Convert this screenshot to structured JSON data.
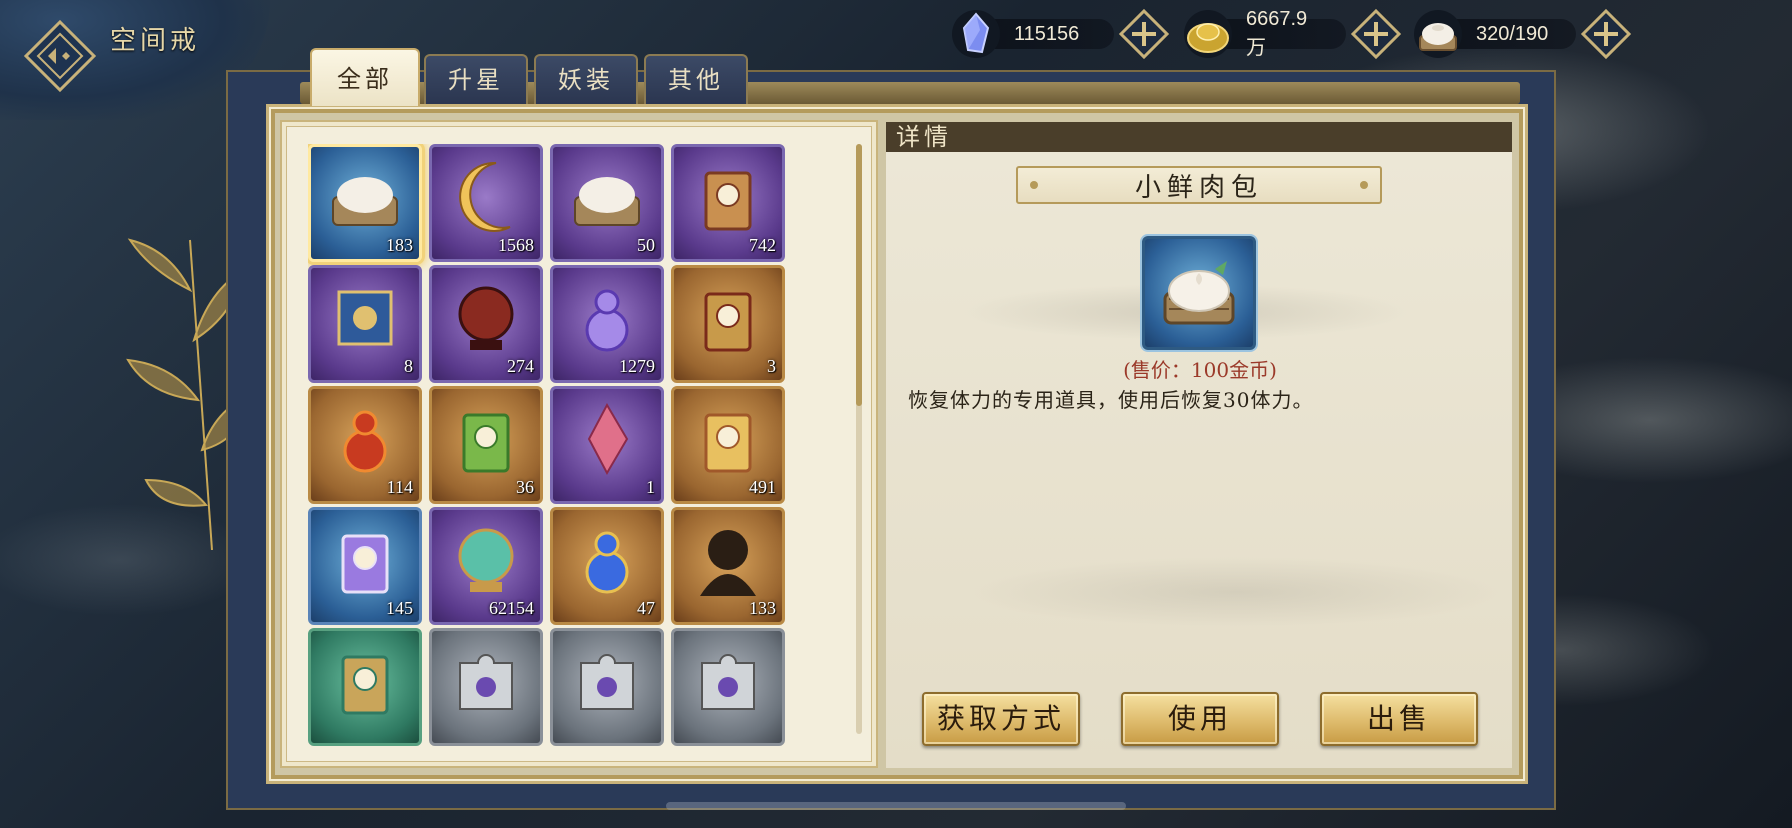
{
  "header": {
    "title": "空间戒",
    "back_icon": "diamond-back-icon"
  },
  "currencies": [
    {
      "name": "crystal",
      "icon": "crystal-icon",
      "value": "115156"
    },
    {
      "name": "gold",
      "icon": "gold-ingot-icon",
      "value": "6667.9万"
    },
    {
      "name": "stamina",
      "icon": "steamed-bun-icon",
      "value": "320/190"
    }
  ],
  "tabs": [
    {
      "label": "全部",
      "active": true
    },
    {
      "label": "升星",
      "active": false
    },
    {
      "label": "妖装",
      "active": false
    },
    {
      "label": "其他",
      "active": false
    }
  ],
  "inventory": {
    "items": [
      {
        "icon": "steamed-bun-icon",
        "count": "183",
        "rarity": "blue",
        "selected": true
      },
      {
        "icon": "crescent-moon-icon",
        "count": "1568",
        "rarity": "purple"
      },
      {
        "icon": "steamed-bun-icon",
        "count": "50",
        "rarity": "purple"
      },
      {
        "icon": "talisman-pouch-icon",
        "count": "742",
        "rarity": "purple"
      },
      {
        "icon": "scroll-icon",
        "count": "8",
        "rarity": "purple"
      },
      {
        "icon": "red-orb-icon",
        "count": "274",
        "rarity": "purple"
      },
      {
        "icon": "purple-gourd-icon",
        "count": "1279",
        "rarity": "purple"
      },
      {
        "icon": "tassel-token-icon",
        "count": "3",
        "rarity": "orange"
      },
      {
        "icon": "red-potion-icon",
        "count": "114",
        "rarity": "orange"
      },
      {
        "icon": "green-talisman-pouch-icon",
        "count": "36",
        "rarity": "orange"
      },
      {
        "icon": "pink-crystal-icon",
        "count": "1",
        "rarity": "purple"
      },
      {
        "icon": "gold-talisman-pouch-icon",
        "count": "491",
        "rarity": "orange"
      },
      {
        "icon": "purple-talisman-pouch-icon",
        "count": "145",
        "rarity": "blue"
      },
      {
        "icon": "jade-orb-icon",
        "count": "62154",
        "rarity": "purple"
      },
      {
        "icon": "blue-gourd-icon",
        "count": "47",
        "rarity": "orange"
      },
      {
        "icon": "silhouette-icon",
        "count": "133",
        "rarity": "orange"
      },
      {
        "icon": "green-item-icon",
        "count": "",
        "rarity": "green"
      },
      {
        "icon": "puzzle-piece-icon",
        "count": "",
        "rarity": "grey"
      },
      {
        "icon": "puzzle-piece-icon",
        "count": "",
        "rarity": "grey"
      },
      {
        "icon": "puzzle-piece-icon",
        "count": "",
        "rarity": "grey"
      }
    ]
  },
  "detail": {
    "header": "详情",
    "item_name": "小鲜肉包",
    "item_icon": "steamed-bun-icon",
    "price": "(售价：100金币)",
    "description": "恢复体力的专用道具，使用后恢复30体力。",
    "buttons": {
      "obtain": "获取方式",
      "use": "使用",
      "sell": "出售"
    }
  },
  "colors": {
    "panel_bg": "#f3eedc",
    "gold_border": "#c9b47c",
    "price_red": "#9b3a2a",
    "button_gold": "#dcb868"
  }
}
